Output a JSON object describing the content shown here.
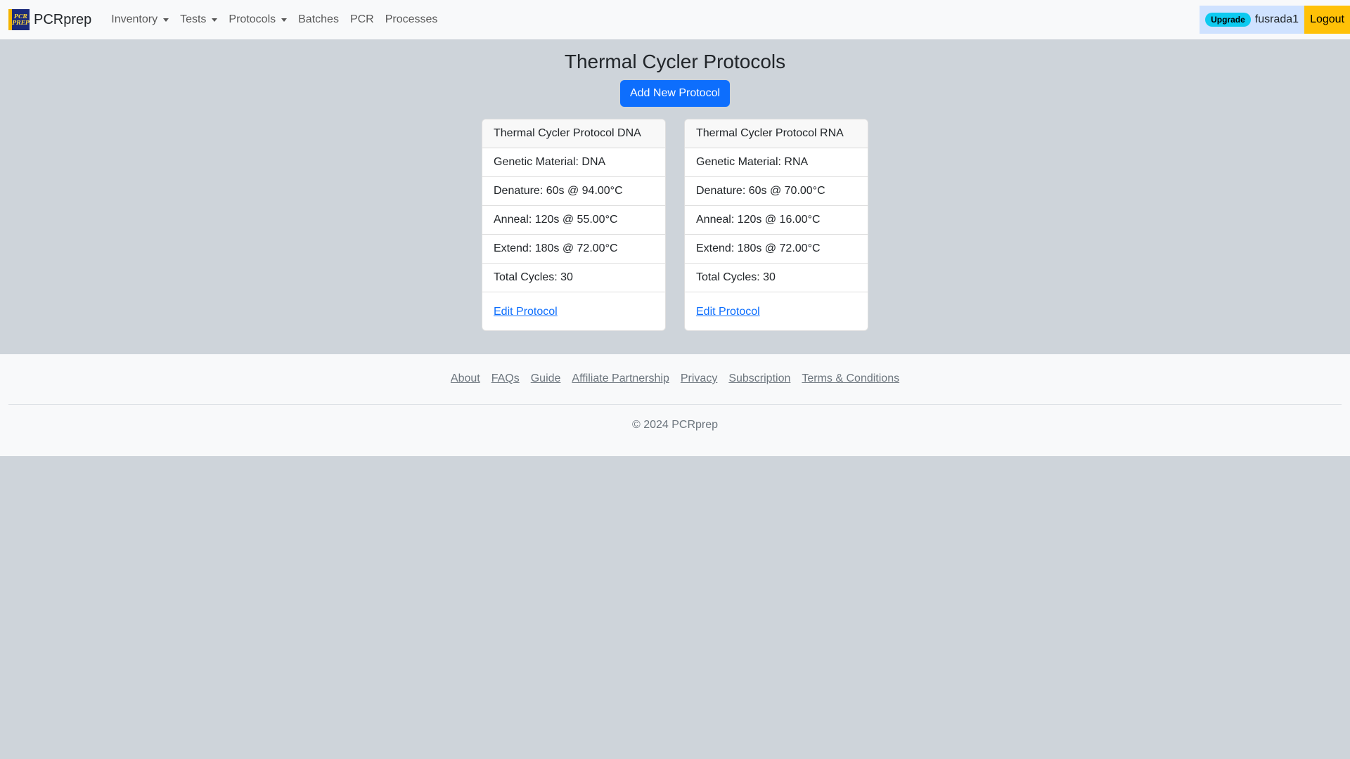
{
  "navbar": {
    "brand": "PCRprep",
    "logo_text_top": "PCR",
    "logo_text_bottom": "PREP",
    "items": [
      {
        "label": "Inventory",
        "dropdown": true
      },
      {
        "label": "Tests",
        "dropdown": true
      },
      {
        "label": "Protocols",
        "dropdown": true
      },
      {
        "label": "Batches",
        "dropdown": false
      },
      {
        "label": "PCR",
        "dropdown": false
      },
      {
        "label": "Processes",
        "dropdown": false
      }
    ],
    "upgrade_badge": "Upgrade",
    "username": "fusrada1",
    "logout": "Logout"
  },
  "main": {
    "title": "Thermal Cycler Protocols",
    "add_button": "Add New Protocol",
    "protocols": [
      {
        "name": "Thermal Cycler Protocol DNA",
        "genetic_material": "Genetic Material: DNA",
        "denature": "Denature: 60s @ 94.00°C",
        "anneal": "Anneal: 120s @ 55.00°C",
        "extend": "Extend: 180s @ 72.00°C",
        "total_cycles": "Total Cycles: 30",
        "edit_link": "Edit Protocol"
      },
      {
        "name": "Thermal Cycler Protocol RNA",
        "genetic_material": "Genetic Material: RNA",
        "denature": "Denature: 60s @ 70.00°C",
        "anneal": "Anneal: 120s @ 16.00°C",
        "extend": "Extend: 180s @ 72.00°C",
        "total_cycles": "Total Cycles: 30",
        "edit_link": "Edit Protocol"
      }
    ]
  },
  "footer": {
    "links": [
      "About",
      "FAQs",
      "Guide",
      "Affiliate Partnership",
      "Privacy",
      "Subscription",
      "Terms & Conditions"
    ],
    "copyright": "© 2024 PCRprep"
  },
  "colors": {
    "page_background": "#ced4da",
    "navbar_background": "#f8f9fa",
    "primary": "#0d6efd",
    "upgrade_badge": "#0dcaf0",
    "user_box": "#cfe2ff",
    "logout": "#ffc107"
  }
}
